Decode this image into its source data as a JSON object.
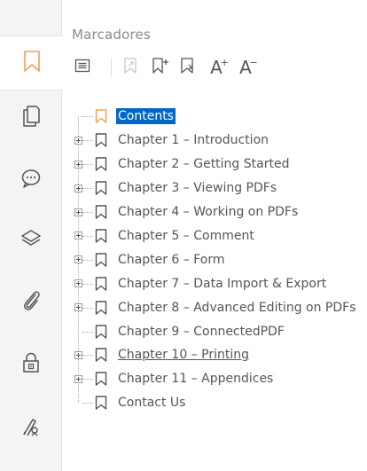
{
  "colors": {
    "accent": "#f0a050",
    "selection": "#0066cc",
    "icon": "#555555"
  },
  "rail": {
    "items": [
      {
        "name": "bookmarks",
        "icon": "bookmark-icon",
        "active": true
      },
      {
        "name": "pages",
        "icon": "pages-icon",
        "active": false
      },
      {
        "name": "comments",
        "icon": "comment-icon",
        "active": false
      },
      {
        "name": "layers",
        "icon": "layers-icon",
        "active": false
      },
      {
        "name": "attachments",
        "icon": "paperclip-icon",
        "active": false
      },
      {
        "name": "security",
        "icon": "lock-icon",
        "active": false
      },
      {
        "name": "signatures",
        "icon": "signature-icon",
        "active": false
      }
    ]
  },
  "panel": {
    "title": "Marcadores",
    "toolbar": {
      "text_size_increase": "A",
      "text_size_decrease": "A",
      "plus_mark": "+",
      "minus_mark": "−"
    }
  },
  "bookmarks": [
    {
      "label": "Contents",
      "expandable": false,
      "selected": true,
      "underlined": false
    },
    {
      "label": "Chapter 1 – Introduction",
      "expandable": true,
      "selected": false,
      "underlined": false
    },
    {
      "label": "Chapter 2 – Getting Started",
      "expandable": true,
      "selected": false,
      "underlined": false
    },
    {
      "label": "Chapter 3 – Viewing PDFs",
      "expandable": true,
      "selected": false,
      "underlined": false
    },
    {
      "label": "Chapter 4 – Working on PDFs",
      "expandable": true,
      "selected": false,
      "underlined": false
    },
    {
      "label": "Chapter 5 – Comment",
      "expandable": true,
      "selected": false,
      "underlined": false
    },
    {
      "label": "Chapter 6 – Form",
      "expandable": true,
      "selected": false,
      "underlined": false
    },
    {
      "label": "Chapter 7 – Data Import & Export",
      "expandable": true,
      "selected": false,
      "underlined": false
    },
    {
      "label": "Chapter 8 – Advanced Editing on PDFs",
      "expandable": true,
      "selected": false,
      "underlined": false
    },
    {
      "label": "Chapter 9 – ConnectedPDF",
      "expandable": false,
      "selected": false,
      "underlined": false
    },
    {
      "label": "Chapter 10 – Printing",
      "expandable": true,
      "selected": false,
      "underlined": true
    },
    {
      "label": "Chapter 11 – Appendices",
      "expandable": true,
      "selected": false,
      "underlined": false
    },
    {
      "label": "Contact Us",
      "expandable": false,
      "selected": false,
      "underlined": false
    }
  ]
}
